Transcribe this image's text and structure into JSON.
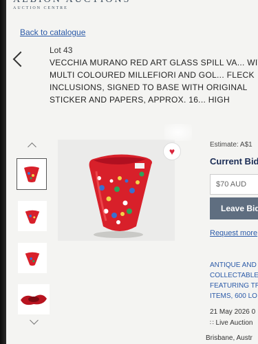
{
  "header": {
    "logo_name": "ALBION AUCTIONS",
    "logo_sub": "AUCTION CENTRE"
  },
  "nav": {
    "back_label": "Back to catalogue"
  },
  "lot": {
    "number_label": "Lot  43",
    "title": "VECCHIA MURANO RED ART GLASS SPILL VA... WITH MULTI COLOURED MILLEFIORI AND GOL... FLECK INCLUSIONS, SIGNED TO BASE WITH ORIGINAL STICKER AND PAPERS, APPROX. 16... HIGH"
  },
  "bidding": {
    "estimate": "Estimate: A$1",
    "current_bid": "Current Bid",
    "bid_value": "$70 AUD",
    "leave_bid_label": "Leave Bid",
    "request_more": "Request more"
  },
  "auction": {
    "name": "ANTIQUE AND\nCOLLECTABLE\nFEATURING TR\nITEMS, 600 LO",
    "date": "21 May 2026 0",
    "mode": "Live Auction",
    "location": "Brisbane, Austr"
  },
  "colors": {
    "accent": "#2b5aa8",
    "button": "#5f6e80",
    "vase": "#d8202a",
    "heart": "#d9263c"
  },
  "icons": [
    "chevron-left-icon",
    "chevron-up-icon",
    "chevron-down-icon",
    "heart-icon",
    "rss-icon"
  ]
}
